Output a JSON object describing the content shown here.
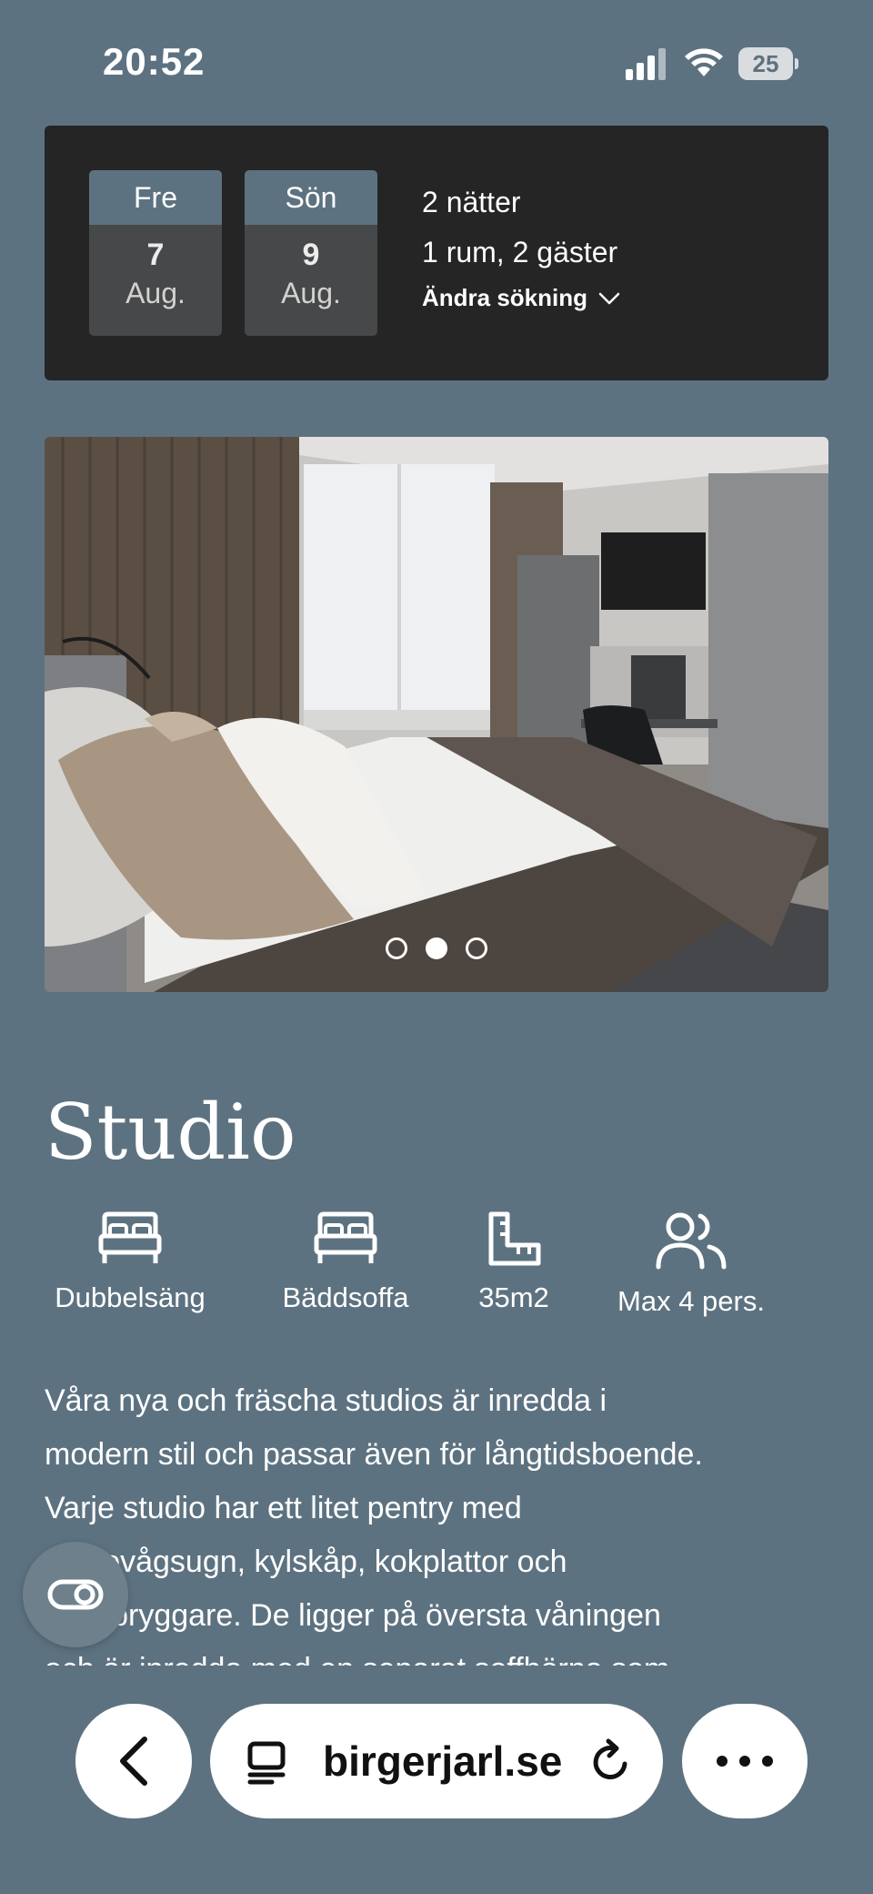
{
  "status_bar": {
    "time": "20:52",
    "battery": "25"
  },
  "booking": {
    "checkin": {
      "weekday": "Fre",
      "day": "7",
      "month": "Aug."
    },
    "checkout": {
      "weekday": "Sön",
      "day": "9",
      "month": "Aug."
    },
    "nights": "2 nätter",
    "rooms_guests": "1 rum, 2 gäster",
    "change_search": "Ändra sökning"
  },
  "gallery": {
    "image_count": 3,
    "active_index": 1
  },
  "room": {
    "title": "Studio",
    "amenities": [
      {
        "icon": "bed-icon",
        "label": "Dubbelsäng"
      },
      {
        "icon": "sofa-bed-icon",
        "label": "Bäddsoffa"
      },
      {
        "icon": "area-icon",
        "label": "35m2"
      },
      {
        "icon": "people-icon",
        "label": "Max 4 pers."
      }
    ],
    "description_lines": [
      "Våra nya och fräscha studios är inredda i",
      "modern stil och passar även för långtidsboende.",
      "Varje studio har ett litet pentry med",
      "mikrovågsugn, kylskåp, kokplattor och",
      "kaffebryggare. De ligger på översta våningen",
      "och är inredda med en separat soffhörna som"
    ]
  },
  "browser": {
    "url": "birgerjarl.se"
  },
  "colors": {
    "background": "#5d7280",
    "panel": "#252526",
    "date_header": "#5d7280"
  }
}
